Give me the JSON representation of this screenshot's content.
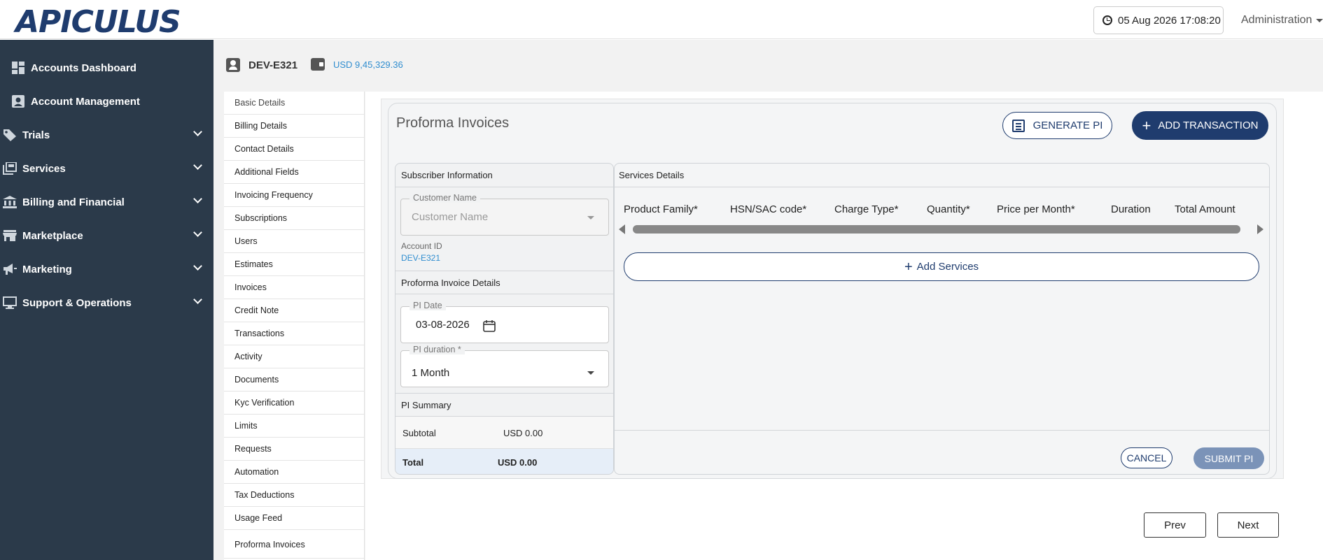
{
  "header": {
    "logo": "APICULUS",
    "datetime": "05 Aug 2026 17:08:20",
    "user_menu": "Administration",
    "icons": [
      "clock-icon",
      "caret-down-icon"
    ]
  },
  "sidebar": {
    "items": [
      {
        "label": "Accounts Dashboard",
        "icon": "dashboard-icon",
        "expandable": false
      },
      {
        "label": "Account Management",
        "icon": "person-icon",
        "expandable": false
      },
      {
        "label": "Trials",
        "icon": "tag-icon",
        "expandable": true
      },
      {
        "label": "Services",
        "icon": "services-icon",
        "expandable": true
      },
      {
        "label": "Billing and Financial",
        "icon": "bank-icon",
        "expandable": true
      },
      {
        "label": "Marketplace",
        "icon": "store-icon",
        "expandable": true
      },
      {
        "label": "Marketing",
        "icon": "megaphone-icon",
        "expandable": true
      },
      {
        "label": "Support & Operations",
        "icon": "monitor-icon",
        "expandable": true
      }
    ]
  },
  "account_bar": {
    "account_id": "DEV-E321",
    "balance": "USD 9,45,329.36"
  },
  "nav_menu": {
    "items": [
      "Basic Details",
      "Billing Details",
      "Contact Details",
      "Additional Fields",
      "Invoicing Frequency",
      "Subscriptions",
      "Users",
      "Estimates",
      "Invoices",
      "Credit Note",
      "Transactions",
      "Activity",
      "Documents",
      "Kyc Verification",
      "Limits",
      "Requests",
      "Automation",
      "Tax Deductions",
      "Usage Feed",
      "Proforma Invoices"
    ]
  },
  "page": {
    "title": "Proforma Invoices",
    "generate_pi": "GENERATE PI",
    "add_transaction": "ADD TRANSACTION"
  },
  "subscriber": {
    "section_title": "Subscriber Information",
    "customer_legend": "Customer Name",
    "customer_placeholder": "Customer Name",
    "account_id_label": "Account ID",
    "account_id_value": "DEV-E321"
  },
  "pi_details": {
    "section_title": "Proforma Invoice Details",
    "date_legend": "PI Date",
    "date_value": "03-08-2026",
    "duration_legend": "PI duration *",
    "duration_value": "1 Month"
  },
  "pi_summary": {
    "section_title": "PI Summary",
    "subtotal_label": "Subtotal",
    "subtotal_value": "USD 0.00",
    "total_label": "Total",
    "total_value": "USD 0.00"
  },
  "services": {
    "section_title": "Services Details",
    "columns": [
      "Product Family*",
      "HSN/SAC code*",
      "Charge Type*",
      "Quantity*",
      "Price per Month*",
      "Duration",
      "Total Amount"
    ],
    "add_services": "Add Services",
    "cancel": "CANCEL",
    "submit": "SUBMIT PI"
  },
  "pager": {
    "prev": "Prev",
    "next": "Next"
  },
  "colors": {
    "sidebar_bg": "#2b3a4a",
    "primary": "#1f3c6e",
    "link": "#2f8dcf",
    "submit_disabled": "#7b93b8"
  }
}
